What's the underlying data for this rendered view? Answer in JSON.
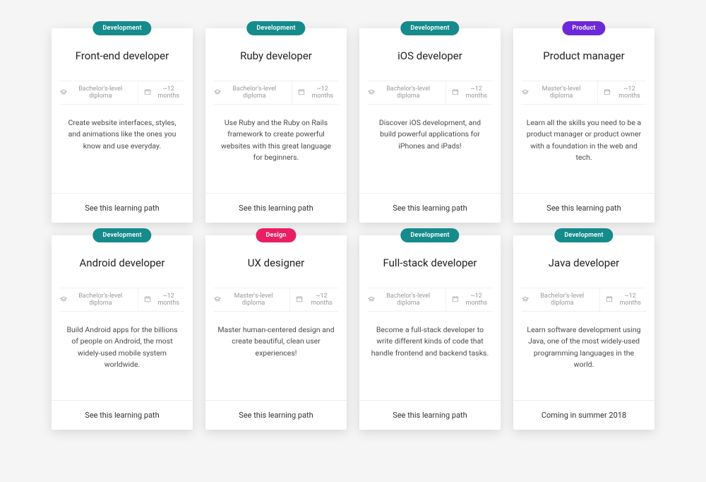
{
  "cards": [
    {
      "badge": "Development",
      "title": "Front-end developer",
      "diploma": "Bachelor's-level diploma",
      "duration": "~12 months",
      "desc": "Create website interfaces, styles, and animations like the ones you know and use everyday.",
      "cta": "See this learning path"
    },
    {
      "badge": "Development",
      "title": "Ruby developer",
      "diploma": "Bachelor's-level diploma",
      "duration": "~12 months",
      "desc": "Use Ruby and the Ruby on Rails framework to create powerful websites with this great language for beginners.",
      "cta": "See this learning path"
    },
    {
      "badge": "Development",
      "title": "iOS developer",
      "diploma": "Bachelor's-level diploma",
      "duration": "~12 months",
      "desc": "Discover iOS development, and build powerful applications for iPhones and iPads!",
      "cta": "See this learning path"
    },
    {
      "badge": "Product",
      "title": "Product manager",
      "diploma": "Master's-level diploma",
      "duration": "~12 months",
      "desc": "Learn all the skills you need to be a product manager or product owner with a foundation in the web and tech.",
      "cta": "See this learning path"
    },
    {
      "badge": "Development",
      "title": "Android developer",
      "diploma": "Bachelor's-level diploma",
      "duration": "~12 months",
      "desc": "Build Android apps for the billions of people on Android, the most widely-used mobile system worldwide.",
      "cta": "See this learning path"
    },
    {
      "badge": "Design",
      "title": "UX designer",
      "diploma": "Master's-level diploma",
      "duration": "~12 months",
      "desc": "Master human-centered design and create beautiful, clean user experiences!",
      "cta": "See this learning path"
    },
    {
      "badge": "Development",
      "title": "Full-stack developer",
      "diploma": "Bachelor's-level diploma",
      "duration": "~12 months",
      "desc": "Become a full-stack developer to write different kinds of code that handle frontend and backend tasks.",
      "cta": "See this learning path"
    },
    {
      "badge": "Development",
      "title": "Java developer",
      "diploma": "Bachelor's-level diploma",
      "duration": "~12 months",
      "desc": "Learn software development using Java, one of the most widely-used programming languages in the world.",
      "cta": "Coming in summer 2018"
    }
  ]
}
